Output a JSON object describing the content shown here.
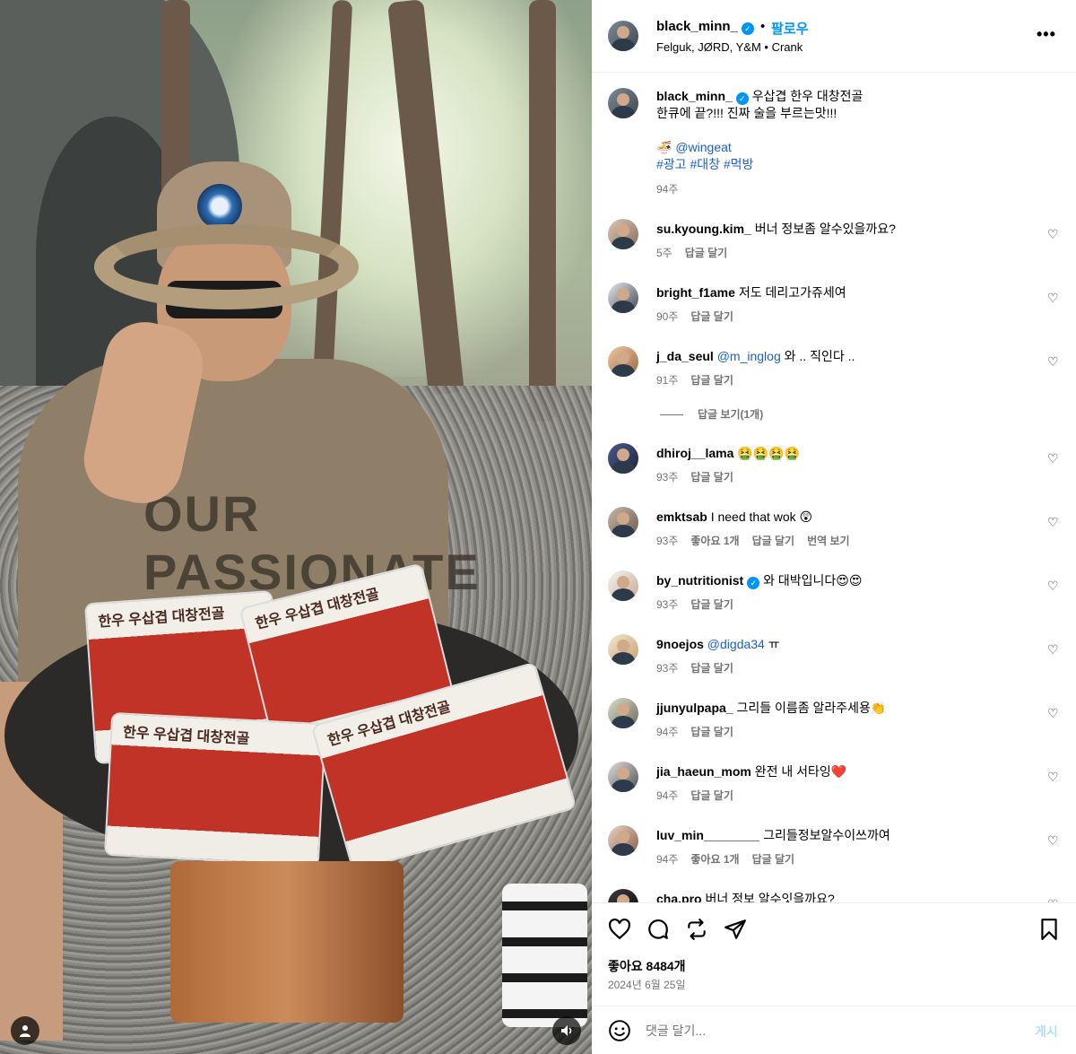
{
  "header": {
    "username": "black_minn_",
    "follow_label": "팔로우",
    "dot": "•",
    "subtitle": "Felguk, JØRD, Y&M • Crank",
    "more_label": "•••"
  },
  "caption": {
    "username": "black_minn_",
    "line1": " 우삽겹 한우 대창전골",
    "line2": "한큐에 끝?!!! 진짜 술을 부르는맛!!!",
    "mention_prefix": "🍜 ",
    "mention": "@wingeat",
    "hashtags": [
      "#광고",
      "#대창",
      "#먹방"
    ],
    "time": "94주"
  },
  "reply_label": "답글 달기",
  "comments": [
    {
      "username": "su.kyoung.kim_",
      "text": "버너 정보좀 알수있을까요?",
      "time": "5주",
      "likes": "",
      "translate": ""
    },
    {
      "username": "bright_f1ame",
      "text": "저도 데리고가쥬세여",
      "time": "90주",
      "likes": "",
      "translate": ""
    },
    {
      "username": "j_da_seul",
      "mention": "@m_inglog",
      "text": "와 .. 직인다 ..",
      "time": "91주",
      "likes": "",
      "translate": ""
    },
    {
      "username": "dhiroj__lama",
      "text": "🤮🤮🤮🤮",
      "time": "93주",
      "likes": "",
      "translate": ""
    },
    {
      "username": "emktsab",
      "text": "I need that wok 😲",
      "time": "93주",
      "likes": "좋아요 1개",
      "translate": "번역 보기"
    },
    {
      "username": "by_nutritionist",
      "verified": true,
      "text": "와 대박입니다😍😍",
      "time": "93주",
      "likes": "",
      "translate": ""
    },
    {
      "username": "9noejos",
      "mention": "@digda34",
      "text": "ㅠ",
      "time": "93주",
      "likes": "",
      "translate": ""
    },
    {
      "username": "jjunyulpapa_",
      "text": "그리들 이름좀 알라주세용👏",
      "time": "94주",
      "likes": "",
      "translate": ""
    },
    {
      "username": "jia_haeun_mom",
      "text": "완전 내 서타잉❤️",
      "time": "94주",
      "likes": "",
      "translate": ""
    },
    {
      "username": "luv_min________",
      "text": "그리들정보알수이쓰까여",
      "time": "94주",
      "likes": "좋아요 1개",
      "translate": ""
    },
    {
      "username": "cha.pro",
      "text": "버너 정보 알수잇을까요?",
      "time": "",
      "likes": "",
      "translate": ""
    }
  ],
  "view_replies_label": "답글 보기(1개)",
  "actions": {
    "likes": "좋아요 8484개",
    "date": "2024년 6월 25일"
  },
  "add_comment": {
    "placeholder": "댓글 달기...",
    "post_label": "게시"
  },
  "media": {
    "pack_title": "한우 우삽겹 대창전골",
    "shirt_text": "OUR PASSIONATE"
  },
  "colors": {
    "accent": "#0095f6",
    "link": "#1a5fd0",
    "muted": "#737373"
  }
}
